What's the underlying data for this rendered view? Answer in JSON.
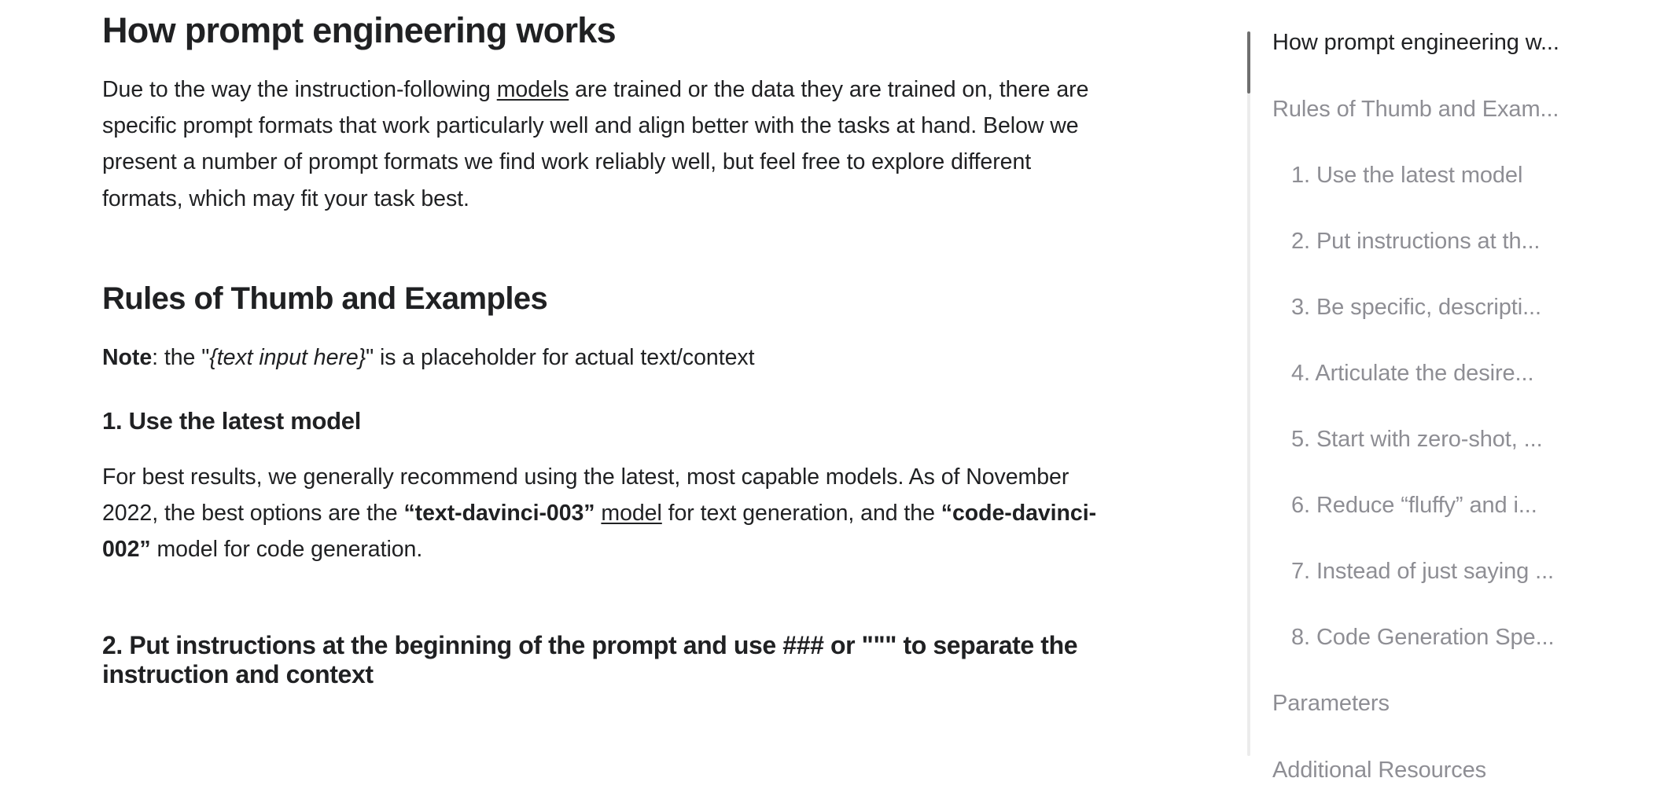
{
  "article": {
    "h1": "How prompt engineering works",
    "intro": {
      "part1": "Due to the way the instruction-following ",
      "link": "models",
      "part2": " are trained or the data they are trained on, there are specific prompt formats that work particularly well and align better with the tasks at hand. Below we present a number of prompt formats we find work reliably well, but feel free to explore different formats, which may fit your task best."
    },
    "h2_rules": "Rules of Thumb and Examples",
    "note": {
      "label": "Note",
      "part1": ": the \"",
      "placeholder": "{text input here}",
      "part2": "\" is a placeholder for actual text/context"
    },
    "h3_rule1": "1. Use the latest model",
    "rule1_body": {
      "part1": "For best results, we generally recommend using the latest, most capable models. As of November 2022, the best options are the ",
      "model_text": "“text-davinci-003”",
      "part2": " ",
      "link": "model",
      "part3": " for text generation, and the ",
      "model_code": "“code-davinci-002”",
      "part4": " model for code generation."
    },
    "h3_rule2": "2. Put instructions at the beginning of the prompt and use ### or \"\"\" to separate the instruction and context"
  },
  "toc": {
    "items": [
      {
        "label": "How prompt engineering w...",
        "level": 1,
        "active": true
      },
      {
        "label": "Rules of Thumb and Exam...",
        "level": 1,
        "active": false
      },
      {
        "label": "1. Use the latest model",
        "level": 2,
        "active": false
      },
      {
        "label": "2. Put instructions at th...",
        "level": 2,
        "active": false
      },
      {
        "label": "3. Be specific, descripti...",
        "level": 2,
        "active": false
      },
      {
        "label": "4. Articulate the desire...",
        "level": 2,
        "active": false
      },
      {
        "label": "5. Start with zero-shot, ...",
        "level": 2,
        "active": false
      },
      {
        "label": "6. Reduce “fluffy” and i...",
        "level": 2,
        "active": false
      },
      {
        "label": "7. Instead of just saying ...",
        "level": 2,
        "active": false
      },
      {
        "label": "8. Code Generation Spe...",
        "level": 2,
        "active": false
      },
      {
        "label": "Parameters",
        "level": 1,
        "active": false
      },
      {
        "label": "Additional Resources",
        "level": 1,
        "active": false
      }
    ]
  },
  "colors": {
    "text": "#202123",
    "muted": "#8e8e94",
    "rail_track": "#ececec",
    "rail_active": "#6f6f6f",
    "background": "#ffffff"
  }
}
